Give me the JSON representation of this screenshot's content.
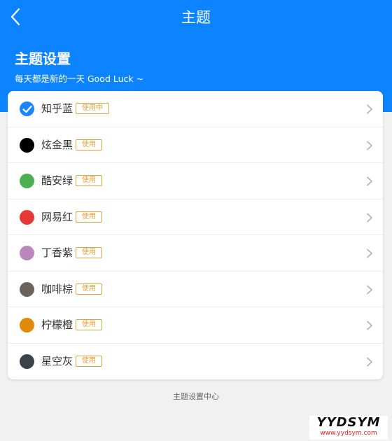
{
  "nav": {
    "title": "主题"
  },
  "hero": {
    "title": "主题设置",
    "subtitle": "每天都是新的一天 Good Luck ~"
  },
  "themes": [
    {
      "name": "知乎蓝",
      "action": "使用中",
      "color": "#1a85ff",
      "selected": true
    },
    {
      "name": "炫金黑",
      "action": "使用",
      "color": "#000000",
      "selected": false
    },
    {
      "name": "酷安绿",
      "action": "使用",
      "color": "#4caf50",
      "selected": false
    },
    {
      "name": "网易红",
      "action": "使用",
      "color": "#e53935",
      "selected": false
    },
    {
      "name": "丁香紫",
      "action": "使用",
      "color": "#b987bd",
      "selected": false
    },
    {
      "name": "咖啡棕",
      "action": "使用",
      "color": "#6b625c",
      "selected": false
    },
    {
      "name": "柠檬橙",
      "action": "使用",
      "color": "#e08a0a",
      "selected": false
    },
    {
      "name": "星空灰",
      "action": "使用",
      "color": "#3c444b",
      "selected": false
    }
  ],
  "footer": {
    "text": "主题设置中心"
  },
  "watermark": {
    "main": "YYDSYM",
    "url": "www.yydsym.com"
  },
  "colors": {
    "primary": "#0d84ff",
    "badge": "#e6a23c",
    "background": "#f1f1f1"
  },
  "icons": {
    "back": "chevron-left-icon",
    "row_arrow": "chevron-right-icon",
    "selected": "check-icon"
  }
}
